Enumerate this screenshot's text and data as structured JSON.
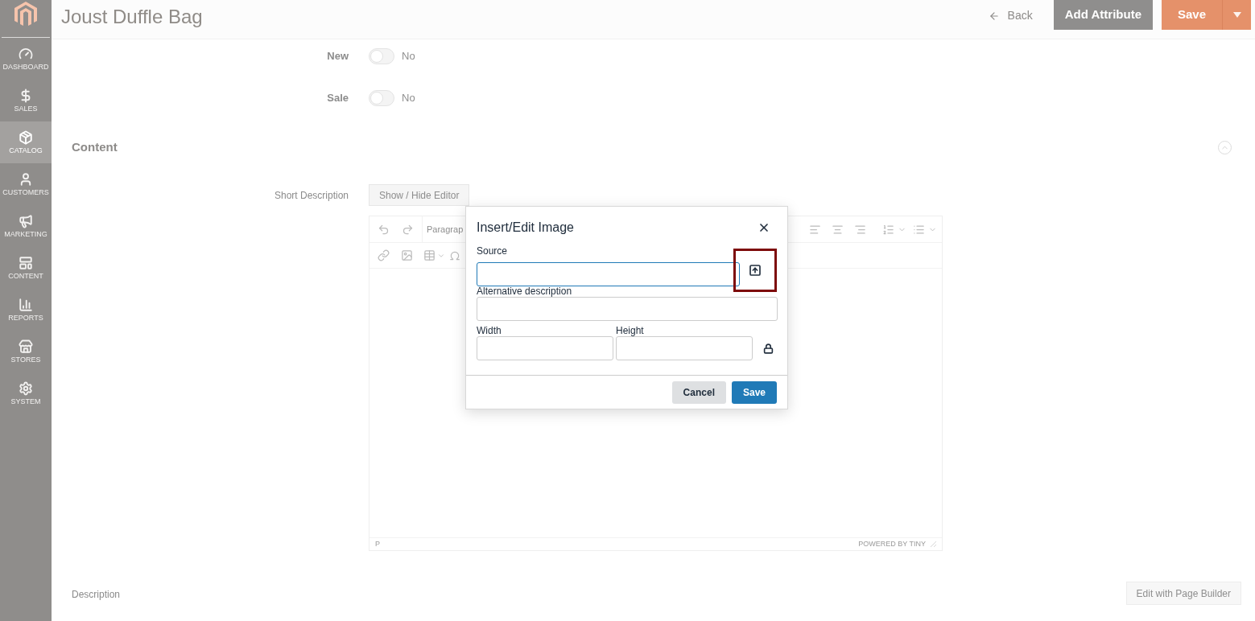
{
  "sidebar": {
    "items": [
      {
        "label": "DASHBOARD",
        "selected": false
      },
      {
        "label": "SALES",
        "selected": false
      },
      {
        "label": "CATALOG",
        "selected": true
      },
      {
        "label": "CUSTOMERS",
        "selected": false
      },
      {
        "label": "MARKETING",
        "selected": false
      },
      {
        "label": "CONTENT",
        "selected": false
      },
      {
        "label": "REPORTS",
        "selected": false
      },
      {
        "label": "STORES",
        "selected": false
      },
      {
        "label": "SYSTEM",
        "selected": false
      }
    ]
  },
  "header": {
    "title": "Joust Duffle Bag",
    "back": "Back",
    "add_attribute": "Add Attribute",
    "save": "Save"
  },
  "fields": [
    {
      "label": "New",
      "on": false,
      "value": "No"
    },
    {
      "label": "Sale",
      "on": false,
      "value": "No"
    }
  ],
  "content_section": {
    "title": "Content",
    "expanded": true
  },
  "short_description": {
    "label": "Short Description",
    "toggle_button": "Show / Hide Editor",
    "editor": {
      "block_format": "Paragrap",
      "status_path": "P",
      "branding": "POWERED BY TINY"
    }
  },
  "dialog": {
    "title": "Insert/Edit Image",
    "source": {
      "label": "Source",
      "focused": true,
      "browse_highlighted": true
    },
    "alt": {
      "label": "Alternative description"
    },
    "width": {
      "label": "Width"
    },
    "height": {
      "label": "Height"
    },
    "cancel": "Cancel",
    "save": "Save"
  },
  "description": {
    "label": "Description",
    "button": "Edit with Page Builder"
  }
}
